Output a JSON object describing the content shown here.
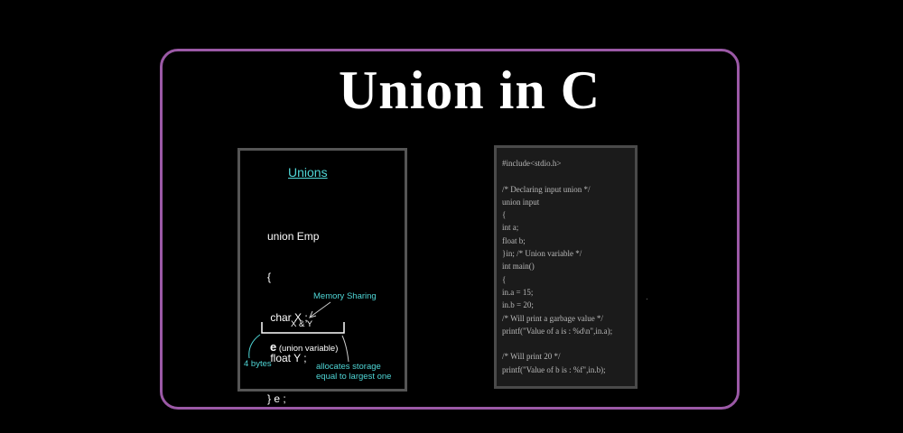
{
  "title": "Union in C",
  "diagram": {
    "heading": "Unions",
    "declaration": [
      "union Emp",
      "{",
      " char X ;",
      " float Y ;",
      "} e ;"
    ],
    "memory_sharing": "Memory Sharing",
    "members": "X & Y",
    "variable_name": "e",
    "variable_note": "(union variable)",
    "bytes": "4 bytes",
    "allocates": [
      "allocates storage",
      "equal to largest one"
    ]
  },
  "code_lines": [
    "#include<stdio.h>",
    "",
    "/* Declaring input union */",
    "union input",
    "{",
    "int a;",
    "float b;",
    "}in; /* Union variable */",
    "int main()",
    "{",
    "in.a = 15;",
    "in.b = 20;",
    "/* Will print a garbage value */",
    "printf(\"Value of a is : %d\\n\",in.a);",
    "",
    "/* Will print 20 */",
    "printf(\"Value of b is : %f\",in.b);"
  ],
  "colors": {
    "frame": "#9b59a6",
    "accent": "#4fd6d6",
    "code_bg": "#1b1b1b"
  }
}
